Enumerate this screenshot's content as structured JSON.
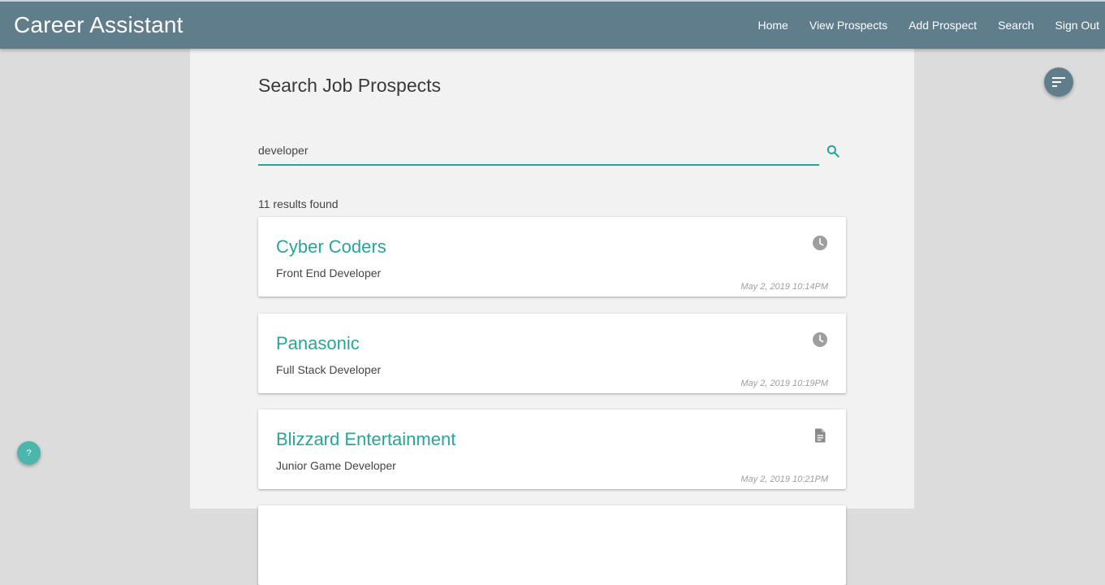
{
  "app": {
    "brand": "Career Assistant",
    "nav": [
      "Home",
      "View Prospects",
      "Add Prospect",
      "Search",
      "Sign Out"
    ]
  },
  "page": {
    "title": "Search Job Prospects"
  },
  "search": {
    "value": "developer",
    "icon": "search-icon"
  },
  "results": {
    "count_text": "11 results found",
    "items": [
      {
        "company": "Cyber Coders",
        "role": "Front End Developer",
        "date": "May 2, 2019 10:14PM",
        "icon": "clock-icon"
      },
      {
        "company": "Panasonic",
        "role": "Full Stack Developer",
        "date": "May 2, 2019 10:19PM",
        "icon": "clock-icon"
      },
      {
        "company": "Blizzard Entertainment",
        "role": "Junior Game Developer",
        "date": "May 2, 2019 10:21PM",
        "icon": "document-icon"
      }
    ]
  },
  "fabs": {
    "sort_icon": "sort-icon",
    "help_label": "?"
  },
  "colors": {
    "navbar": "#607d8b",
    "accent": "#26a69a",
    "help_button": "#4db6ac",
    "background": "#dcdcdc",
    "content": "#f2f2f2"
  }
}
